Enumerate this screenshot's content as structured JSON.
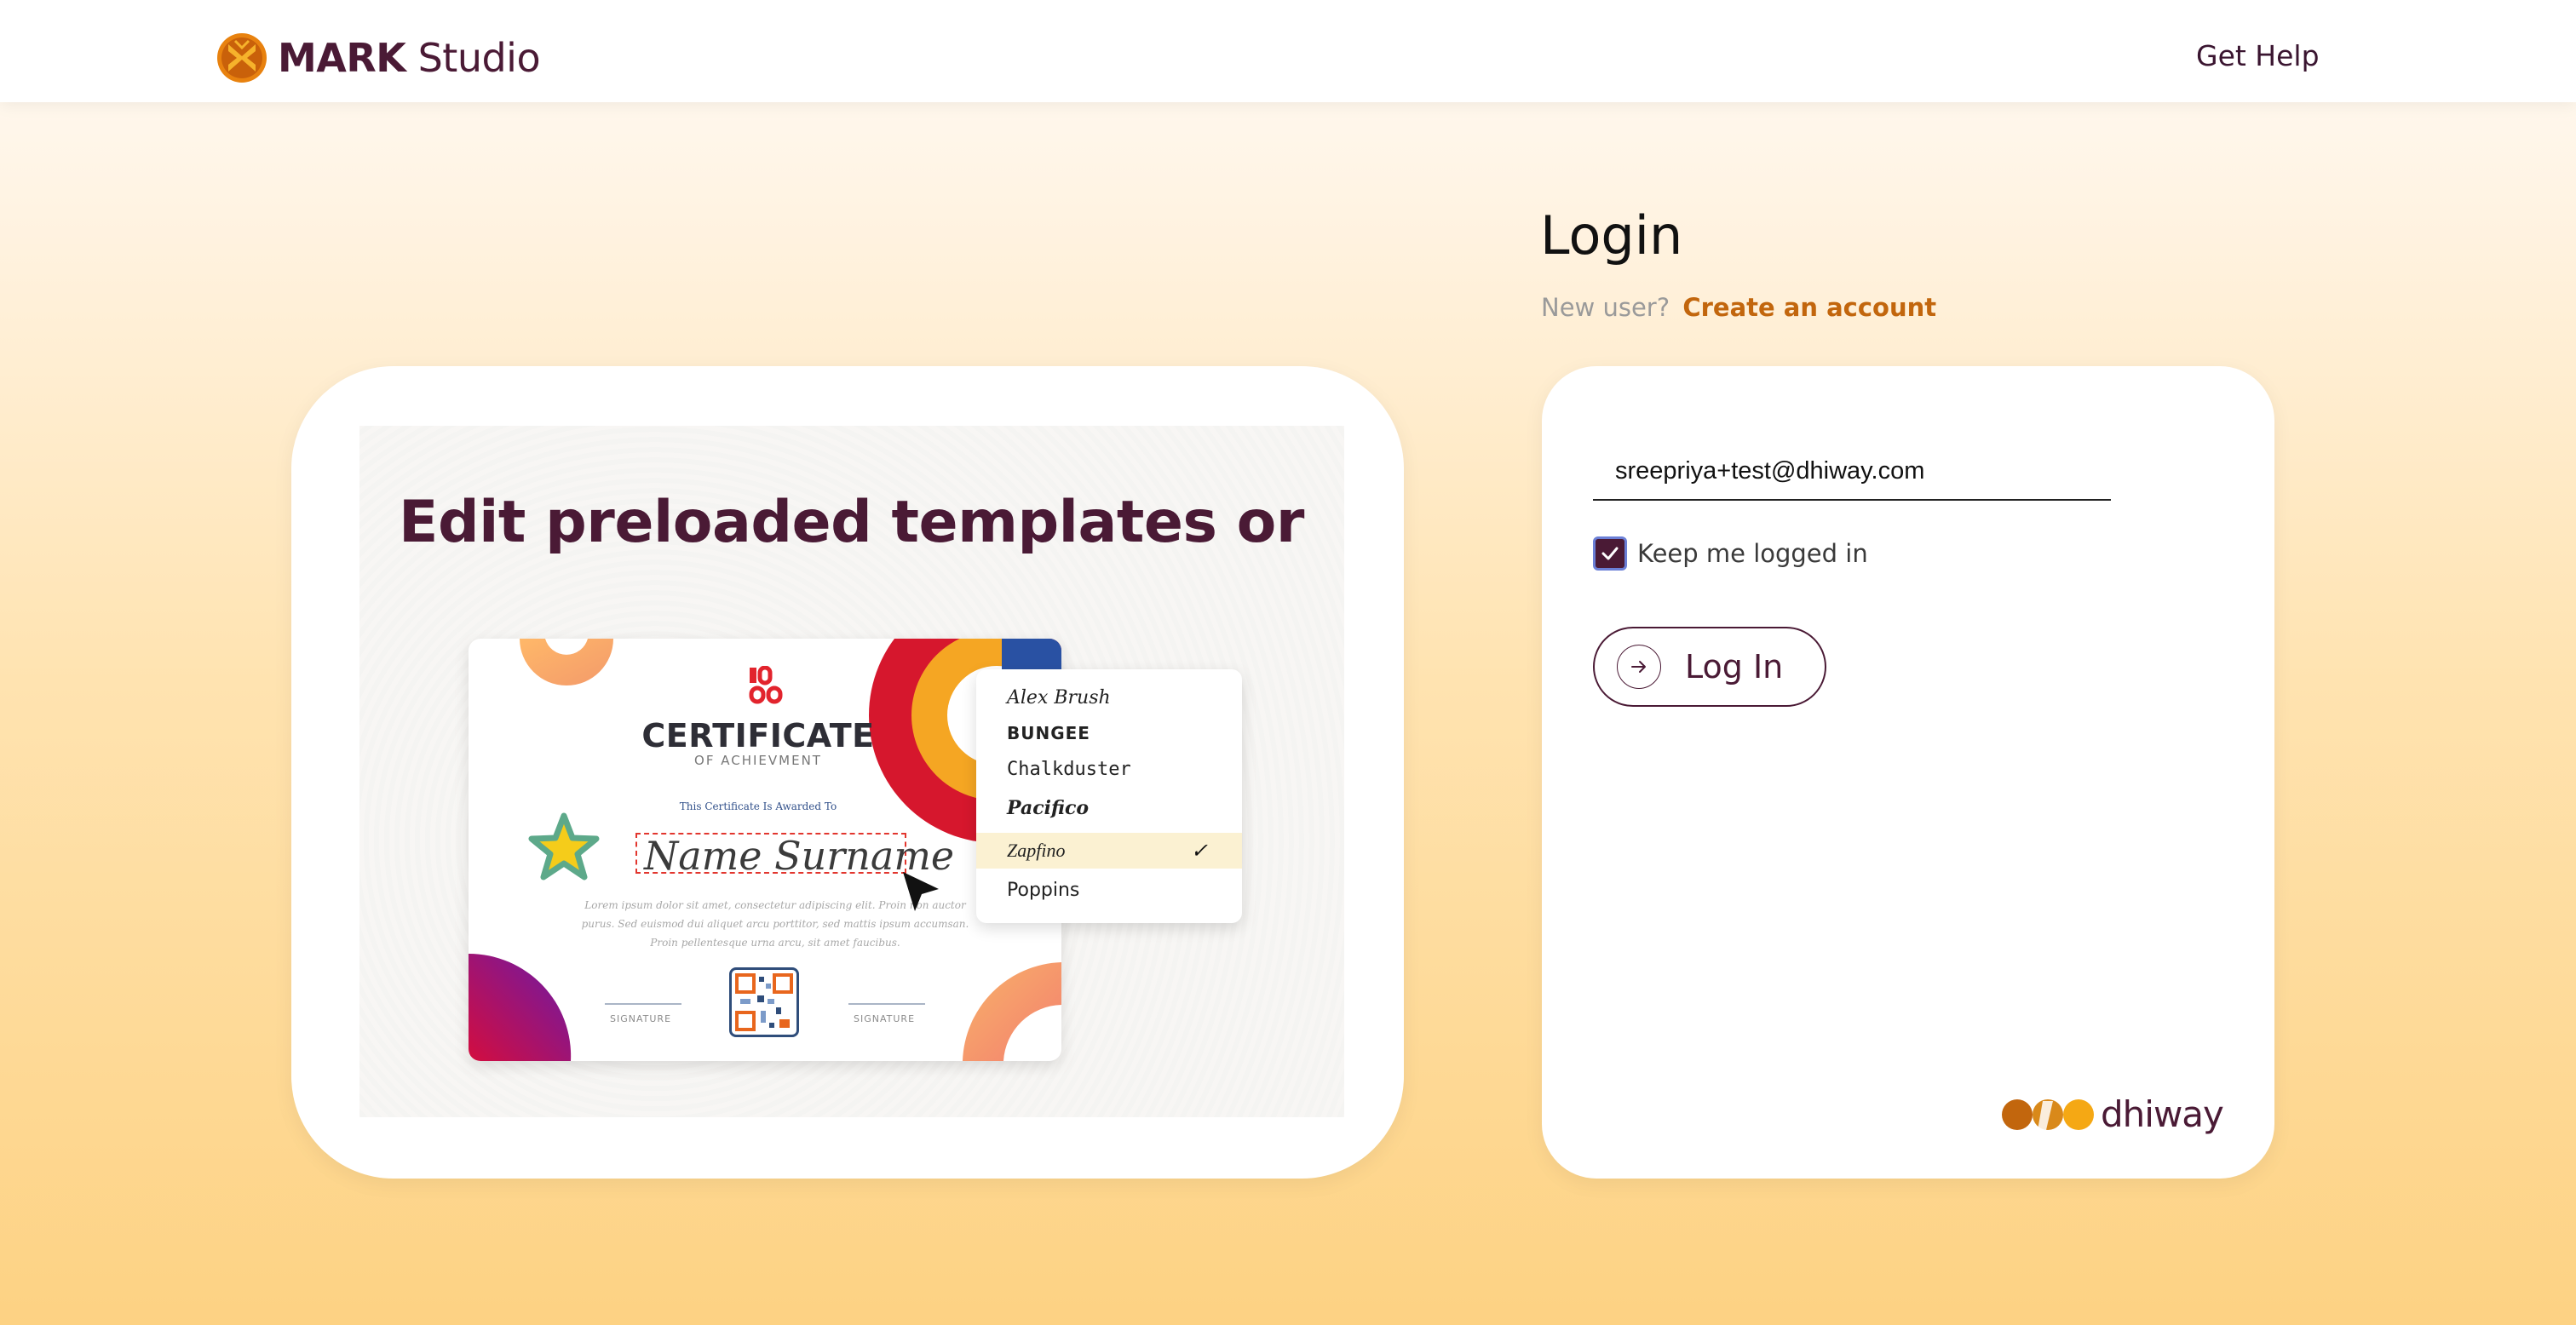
{
  "header": {
    "brand_bold": "MARK",
    "brand_light": "Studio",
    "help_label": "Get Help"
  },
  "promo": {
    "heading": "Edit preloaded templates or",
    "certificate": {
      "logo_text": "LOGO",
      "title": "CERTIFICATE",
      "subtitle": "OF ACHIEVMENT",
      "awarded": "This Certificate Is Awarded To",
      "name": "Name Surname",
      "lorem": "Lorem ipsum dolor sit amet, consectetur adipiscing elit. Proin non auctor purus. Sed euismod dui aliquet arcu porttitor, sed mattis ipsum accumsan. Proin pellentesque urna arcu, sit amet faucibus.",
      "signature_left": "SIGNATURE",
      "signature_right": "SIGNATURE"
    },
    "font_menu": {
      "items": [
        "Alex Brush",
        "BUNGEE",
        "Chalkduster",
        "Pacifico",
        "Zapfino",
        "Poppins"
      ],
      "selected": "Zapfino",
      "check": "✓"
    }
  },
  "login": {
    "title": "Login",
    "new_user_text": "New user?",
    "create_account": "Create an account",
    "email_value": "sreepriya+test@dhiway.com",
    "keep_logged_in": "Keep me logged in",
    "keep_checked": true,
    "button_label": "Log In",
    "footer_brand": "dhiway"
  },
  "colors": {
    "brand": "#4a1a35",
    "accent": "#c2660d",
    "selected_row": "#fbf1d2"
  }
}
